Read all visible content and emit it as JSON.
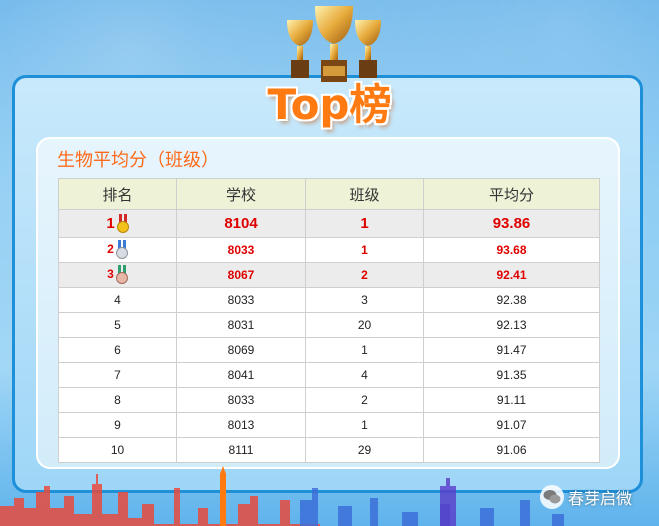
{
  "header": {
    "title": "Top榜",
    "subtitle": "生物平均分（班级）"
  },
  "table": {
    "columns": [
      "排名",
      "学校",
      "班级",
      "平均分"
    ],
    "rows": [
      {
        "rank": "1",
        "school": "8104",
        "class": "1",
        "avg": "93.86"
      },
      {
        "rank": "2",
        "school": "8033",
        "class": "1",
        "avg": "93.68"
      },
      {
        "rank": "3",
        "school": "8067",
        "class": "2",
        "avg": "92.41"
      },
      {
        "rank": "4",
        "school": "8033",
        "class": "3",
        "avg": "92.38"
      },
      {
        "rank": "5",
        "school": "8031",
        "class": "20",
        "avg": "92.13"
      },
      {
        "rank": "6",
        "school": "8069",
        "class": "1",
        "avg": "91.47"
      },
      {
        "rank": "7",
        "school": "8041",
        "class": "4",
        "avg": "91.35"
      },
      {
        "rank": "8",
        "school": "8033",
        "class": "2",
        "avg": "91.11"
      },
      {
        "rank": "9",
        "school": "8013",
        "class": "1",
        "avg": "91.07"
      },
      {
        "rank": "10",
        "school": "8111",
        "class": "29",
        "avg": "91.06"
      }
    ]
  },
  "watermark": {
    "text": "春芽启微",
    "icon": "wechat-icon"
  },
  "colors": {
    "title": "#ff7a10",
    "subtitle": "#ff6a1a",
    "highlight": "#e00000",
    "header_bg": "#eef3d8",
    "frame": "#1e8fd9"
  }
}
